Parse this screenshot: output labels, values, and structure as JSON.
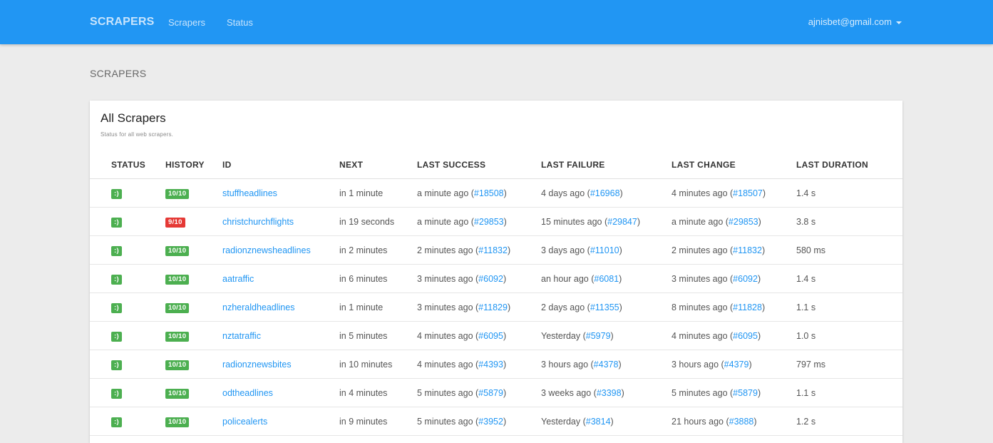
{
  "navbar": {
    "brand": "SCRAPERS",
    "links": [
      "Scrapers",
      "Status"
    ],
    "user_email": "ajnisbet@gmail.com"
  },
  "page": {
    "heading": "SCRAPERS"
  },
  "card": {
    "title": "All Scrapers",
    "subtitle": "Status for all web scrapers."
  },
  "table": {
    "headers": [
      "STATUS",
      "HISTORY",
      "ID",
      "NEXT",
      "LAST SUCCESS",
      "LAST FAILURE",
      "LAST CHANGE",
      "LAST DURATION"
    ],
    "rows": [
      {
        "status": ":)",
        "history": "10/10",
        "history_ok": true,
        "id": "stuffheadlines",
        "next": "in 1 minute",
        "success_text": "a minute ago",
        "success_link": "#18508",
        "failure_text": "4 days ago",
        "failure_link": "#16968",
        "change_text": "4 minutes ago",
        "change_link": "#18507",
        "duration": "1.4 s"
      },
      {
        "status": ":)",
        "history": "9/10",
        "history_ok": false,
        "id": "christchurchflights",
        "next": "in 19 seconds",
        "success_text": "a minute ago",
        "success_link": "#29853",
        "failure_text": "15 minutes ago",
        "failure_link": "#29847",
        "change_text": "a minute ago",
        "change_link": "#29853",
        "duration": "3.8 s"
      },
      {
        "status": ":)",
        "history": "10/10",
        "history_ok": true,
        "id": "radionznewsheadlines",
        "next": "in 2 minutes",
        "success_text": "2 minutes ago",
        "success_link": "#11832",
        "failure_text": "3 days ago",
        "failure_link": "#11010",
        "change_text": "2 minutes ago",
        "change_link": "#11832",
        "duration": "580 ms"
      },
      {
        "status": ":)",
        "history": "10/10",
        "history_ok": true,
        "id": "aatraffic",
        "next": "in 6 minutes",
        "success_text": "3 minutes ago",
        "success_link": "#6092",
        "failure_text": "an hour ago",
        "failure_link": "#6081",
        "change_text": "3 minutes ago",
        "change_link": "#6092",
        "duration": "1.4 s"
      },
      {
        "status": ":)",
        "history": "10/10",
        "history_ok": true,
        "id": "nzheraldheadlines",
        "next": "in 1 minute",
        "success_text": "3 minutes ago",
        "success_link": "#11829",
        "failure_text": "2 days ago",
        "failure_link": "#11355",
        "change_text": "8 minutes ago",
        "change_link": "#11828",
        "duration": "1.1 s"
      },
      {
        "status": ":)",
        "history": "10/10",
        "history_ok": true,
        "id": "nztatraffic",
        "next": "in 5 minutes",
        "success_text": "4 minutes ago",
        "success_link": "#6095",
        "failure_text": "Yesterday",
        "failure_link": "#5979",
        "change_text": "4 minutes ago",
        "change_link": "#6095",
        "duration": "1.0 s"
      },
      {
        "status": ":)",
        "history": "10/10",
        "history_ok": true,
        "id": "radionznewsbites",
        "next": "in 10 minutes",
        "success_text": "4 minutes ago",
        "success_link": "#4393",
        "failure_text": "3 hours ago",
        "failure_link": "#4378",
        "change_text": "3 hours ago",
        "change_link": "#4379",
        "duration": "797 ms"
      },
      {
        "status": ":)",
        "history": "10/10",
        "history_ok": true,
        "id": "odtheadlines",
        "next": "in 4 minutes",
        "success_text": "5 minutes ago",
        "success_link": "#5879",
        "failure_text": "3 weeks ago",
        "failure_link": "#3398",
        "change_text": "5 minutes ago",
        "change_link": "#5879",
        "duration": "1.1 s"
      },
      {
        "status": ":)",
        "history": "10/10",
        "history_ok": true,
        "id": "policealerts",
        "next": "in 9 minutes",
        "success_text": "5 minutes ago",
        "success_link": "#3952",
        "failure_text": "Yesterday",
        "failure_link": "#3814",
        "change_text": "21 hours ago",
        "change_link": "#3888",
        "duration": "1.2 s"
      }
    ]
  },
  "colors": {
    "navbar": "#2196f3",
    "link": "#2196f3",
    "badge_ok": "#4caf50",
    "badge_bad": "#e53935",
    "background": "#ececec"
  }
}
